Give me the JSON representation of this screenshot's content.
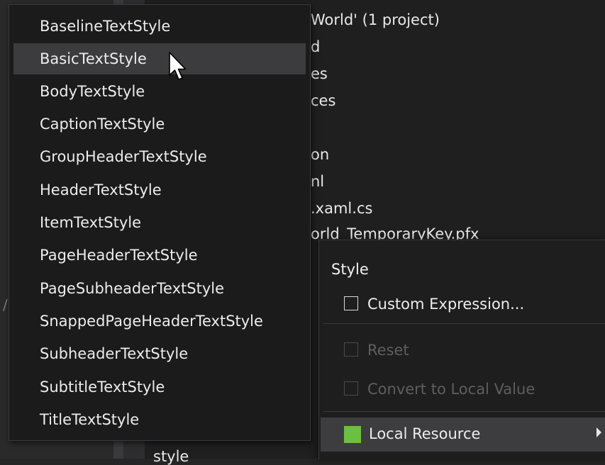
{
  "explorer": {
    "lines": [
      "World' (1 project)",
      "d",
      "es",
      "ces",
      "on",
      "nl",
      ".xaml.cs",
      "orld_TemporaryKey.pfx",
      "style"
    ]
  },
  "style_menu": {
    "items": [
      "BaselineTextStyle",
      "BasicTextStyle",
      "BodyTextStyle",
      "CaptionTextStyle",
      "GroupHeaderTextStyle",
      "HeaderTextStyle",
      "ItemTextStyle",
      "PageHeaderTextStyle",
      "PageSubheaderTextStyle",
      "SnappedPageHeaderTextStyle",
      "SubheaderTextStyle",
      "SubtitleTextStyle",
      "TitleTextStyle"
    ],
    "selected": "BasicTextStyle"
  },
  "context_menu": {
    "heading": "Style",
    "custom_expression": "Custom Expression...",
    "reset": "Reset",
    "convert_to_local": "Convert to Local Value",
    "local_resource": "Local Resource",
    "local_resource_color": "#6cbf3f"
  },
  "colors": {
    "menu_background": "#1b1b1c",
    "selection_background": "#3c3c3e",
    "text": "#ececec",
    "disabled_text": "#5e5e5e"
  }
}
